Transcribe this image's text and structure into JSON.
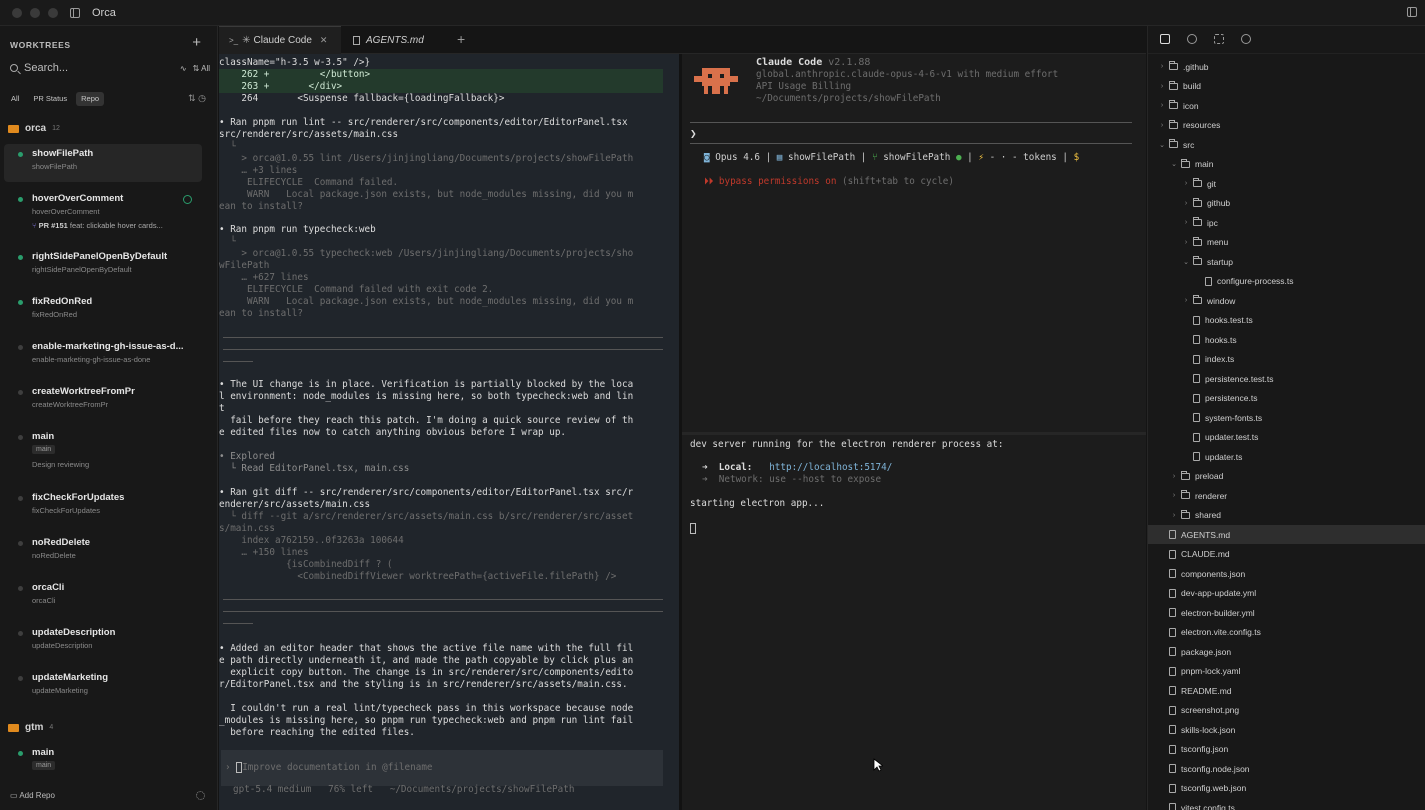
{
  "window": {
    "title": "Orca"
  },
  "sidebar": {
    "heading": "WORKTREES",
    "search_placeholder": "Search...",
    "search_right": "All",
    "filters": [
      "All",
      "PR Status",
      "Repo"
    ],
    "repos": [
      {
        "name": "orca",
        "count": "12"
      },
      {
        "name": "gtm",
        "count": "4"
      }
    ],
    "worktrees": [
      {
        "name": "showFilePath",
        "branch": "showFilePath"
      },
      {
        "name": "hoverOverComment",
        "branch": "hoverOverComment",
        "pr_num": "PR #151",
        "pr_title": "feat: clickable hover cards..."
      },
      {
        "name": "rightSidePanelOpenByDefault",
        "branch": "rightSidePanelOpenByDefault"
      },
      {
        "name": "fixRedOnRed",
        "branch": "fixRedOnRed"
      },
      {
        "name": "enable-marketing-gh-issue-as-d...",
        "branch": "enable-marketing-gh-issue-as-done"
      },
      {
        "name": "createWorktreeFromPr",
        "branch": "createWorktreeFromPr"
      },
      {
        "name": "main",
        "branch": "main",
        "note": "Design reviewing"
      },
      {
        "name": "fixCheckForUpdates",
        "branch": "fixCheckForUpdates"
      },
      {
        "name": "noRedDelete",
        "branch": "noRedDelete"
      },
      {
        "name": "orcaCli",
        "branch": "orcaCli"
      },
      {
        "name": "updateDescription",
        "branch": "updateDescription"
      },
      {
        "name": "updateMarketing",
        "branch": "updateMarketing"
      },
      {
        "name": "main",
        "branch": "main"
      }
    ],
    "add_repo": "Add Repo"
  },
  "tabs": [
    {
      "label": "Claude Code",
      "prefix": ">_"
    },
    {
      "label": "AGENTS.md"
    }
  ],
  "terminal_left": {
    "lines": [
      "className=\"h-3.5 w-3.5\" />}",
      "    262 +         </button>",
      "    263 +       </div>",
      "    264       <Suspense fallback={loadingFallback}>",
      "• Ran pnpm run lint -- src/renderer/src/components/editor/EditorPanel.tsx",
      "src/renderer/src/assets/main.css",
      "  └",
      "    > orca@1.0.55 lint /Users/jinjingliang/Documents/projects/showFilePath",
      "    … +3 lines",
      "     ELIFECYCLE  Command failed.",
      "     WARN   Local package.json exists, but node_modules missing, did you m",
      "ean to install?",
      "• Ran pnpm run typecheck:web",
      "  └",
      "    > orca@1.0.55 typecheck:web /Users/jinjingliang/Documents/projects/sho",
      "wFilePath",
      "    … +627 lines",
      "     ELIFECYCLE  Command failed with exit code 2.",
      "     WARN   Local package.json exists, but node_modules missing, did you m",
      "ean to install?",
      "• The UI change is in place. Verification is partially blocked by the loca",
      "l environment: node_modules is missing here, so both typecheck:web and lin",
      "t",
      "  fail before they reach this patch. I'm doing a quick source review of th",
      "e edited files now to catch anything obvious before I wrap up.",
      "• Explored",
      "  └ Read EditorPanel.tsx, main.css",
      "• Ran git diff -- src/renderer/src/components/editor/EditorPanel.tsx src/r",
      "enderer/src/assets/main.css",
      "  └ diff --git a/src/renderer/src/assets/main.css b/src/renderer/src/asset",
      "s/main.css",
      "    index a762159..0f3263a 100644",
      "    … +150 lines",
      "            {isCombinedDiff ? (",
      "              <CombinedDiffViewer worktreePath={activeFile.filePath} />",
      "• Added an editor header that shows the active file name with the full fil",
      "e path directly underneath it, and made the path copyable by click plus an",
      "  explicit copy button. The change is in src/renderer/src/components/edito",
      "r/EditorPanel.tsx and the styling is in src/renderer/src/assets/main.css.",
      "  I couldn't run a real lint/typecheck pass in this workspace because node",
      "_modules is missing here, so pnpm run typecheck:web and pnpm run lint fail",
      "  before reaching the edited files."
    ],
    "prompt_placeholder": "Improve documentation in @filename",
    "status": "gpt-5.4 medium   76% left   ~/Documents/projects/showFilePath"
  },
  "claude_pane": {
    "title": "Claude Code",
    "version": "v2.1.88",
    "model_line": "global.anthropic.claude-opus-4-6-v1 with medium effort",
    "billing": "API Usage Billing",
    "path": "~/Documents/projects/showFilePath",
    "prompt_char": "❯",
    "status_model": "Opus 4.6",
    "status_folder": "showFilePath",
    "status_branch": "showFilePath",
    "status_tokens": "- · - tokens",
    "bypass": "⏵⏵ bypass permissions on",
    "bypass_hint": "(shift+tab to cycle)"
  },
  "dev_pane": {
    "line1": "dev server running for the electron renderer process at:",
    "local_label": "Local:",
    "local_url": "http://localhost:5174/",
    "network": "Network: use --host to expose",
    "starting": "starting electron app..."
  },
  "file_tree": {
    "items": [
      {
        "name": ".github",
        "type": "folder",
        "depth": 0,
        "open": false
      },
      {
        "name": "build",
        "type": "folder",
        "depth": 0,
        "open": false
      },
      {
        "name": "icon",
        "type": "folder",
        "depth": 0,
        "open": false
      },
      {
        "name": "resources",
        "type": "folder",
        "depth": 0,
        "open": false
      },
      {
        "name": "src",
        "type": "folder",
        "depth": 0,
        "open": true
      },
      {
        "name": "main",
        "type": "folder",
        "depth": 1,
        "open": true
      },
      {
        "name": "git",
        "type": "folder",
        "depth": 2,
        "open": false
      },
      {
        "name": "github",
        "type": "folder",
        "depth": 2,
        "open": false
      },
      {
        "name": "ipc",
        "type": "folder",
        "depth": 2,
        "open": false
      },
      {
        "name": "menu",
        "type": "folder",
        "depth": 2,
        "open": false
      },
      {
        "name": "startup",
        "type": "folder",
        "depth": 2,
        "open": true
      },
      {
        "name": "configure-process.ts",
        "type": "file",
        "depth": 3
      },
      {
        "name": "window",
        "type": "folder",
        "depth": 2,
        "open": false
      },
      {
        "name": "hooks.test.ts",
        "type": "file",
        "depth": 2
      },
      {
        "name": "hooks.ts",
        "type": "file",
        "depth": 2
      },
      {
        "name": "index.ts",
        "type": "file",
        "depth": 2
      },
      {
        "name": "persistence.test.ts",
        "type": "file",
        "depth": 2
      },
      {
        "name": "persistence.ts",
        "type": "file",
        "depth": 2
      },
      {
        "name": "system-fonts.ts",
        "type": "file",
        "depth": 2
      },
      {
        "name": "updater.test.ts",
        "type": "file",
        "depth": 2
      },
      {
        "name": "updater.ts",
        "type": "file",
        "depth": 2
      },
      {
        "name": "preload",
        "type": "folder",
        "depth": 1,
        "open": false
      },
      {
        "name": "renderer",
        "type": "folder",
        "depth": 1,
        "open": false
      },
      {
        "name": "shared",
        "type": "folder",
        "depth": 1,
        "open": false
      },
      {
        "name": "AGENTS.md",
        "type": "file",
        "depth": 0,
        "selected": true
      },
      {
        "name": "CLAUDE.md",
        "type": "file",
        "depth": 0
      },
      {
        "name": "components.json",
        "type": "file",
        "depth": 0
      },
      {
        "name": "dev-app-update.yml",
        "type": "file",
        "depth": 0
      },
      {
        "name": "electron-builder.yml",
        "type": "file",
        "depth": 0
      },
      {
        "name": "electron.vite.config.ts",
        "type": "file",
        "depth": 0
      },
      {
        "name": "package.json",
        "type": "file",
        "depth": 0
      },
      {
        "name": "pnpm-lock.yaml",
        "type": "file",
        "depth": 0
      },
      {
        "name": "README.md",
        "type": "file",
        "depth": 0
      },
      {
        "name": "screenshot.png",
        "type": "file",
        "depth": 0
      },
      {
        "name": "skills-lock.json",
        "type": "file",
        "depth": 0
      },
      {
        "name": "tsconfig.json",
        "type": "file",
        "depth": 0
      },
      {
        "name": "tsconfig.node.json",
        "type": "file",
        "depth": 0
      },
      {
        "name": "tsconfig.web.json",
        "type": "file",
        "depth": 0
      },
      {
        "name": "vitest.config.ts",
        "type": "file",
        "depth": 0
      }
    ]
  },
  "colors": {
    "accent_green": "#2a9d6c",
    "repo_orange": "#e08a1e",
    "claude_orange": "#d9714b",
    "bypass_red": "#c0392b"
  }
}
